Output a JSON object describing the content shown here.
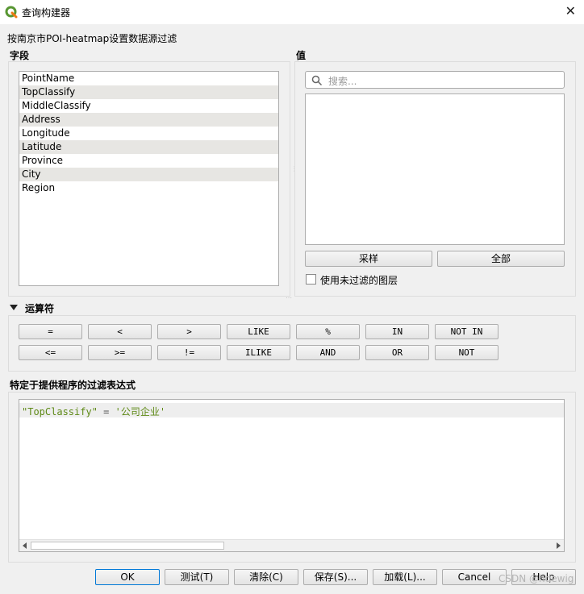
{
  "window": {
    "title": "查询构建器",
    "subtitle": "按南京市POI-heatmap设置数据源过滤",
    "close_glyph": "✕",
    "app_icon": "qgis-logo-icon",
    "brand_color": "#589632"
  },
  "fields": {
    "label": "字段",
    "items": [
      "PointName",
      "TopClassify",
      "MiddleClassify",
      "Address",
      "Longitude",
      "Latitude",
      "Province",
      "City",
      "Region"
    ]
  },
  "values": {
    "label": "值",
    "search_placeholder": "搜索...",
    "sample_button": "采样",
    "all_button": "全部",
    "use_unfiltered_label": "使用未过滤的图层",
    "use_unfiltered_checked": false
  },
  "operators": {
    "label": "运算符",
    "row1": [
      "=",
      "<",
      ">",
      "LIKE",
      "%",
      "IN",
      "NOT IN"
    ],
    "row2": [
      "<=",
      ">=",
      "!=",
      "ILIKE",
      "AND",
      "OR",
      "NOT"
    ]
  },
  "expression": {
    "label": "特定于提供程序的过滤表达式",
    "field_token": "\"TopClassify\"",
    "operator_token": " = ",
    "value_token": "'公司企业'"
  },
  "buttons": {
    "ok": "OK",
    "test": "测试(T)",
    "clear": "清除(C)",
    "save": "保存(S)...",
    "load": "加载(L)...",
    "cancel": "Cancel",
    "help": "Help"
  },
  "watermark": "CSDN @hdewig"
}
